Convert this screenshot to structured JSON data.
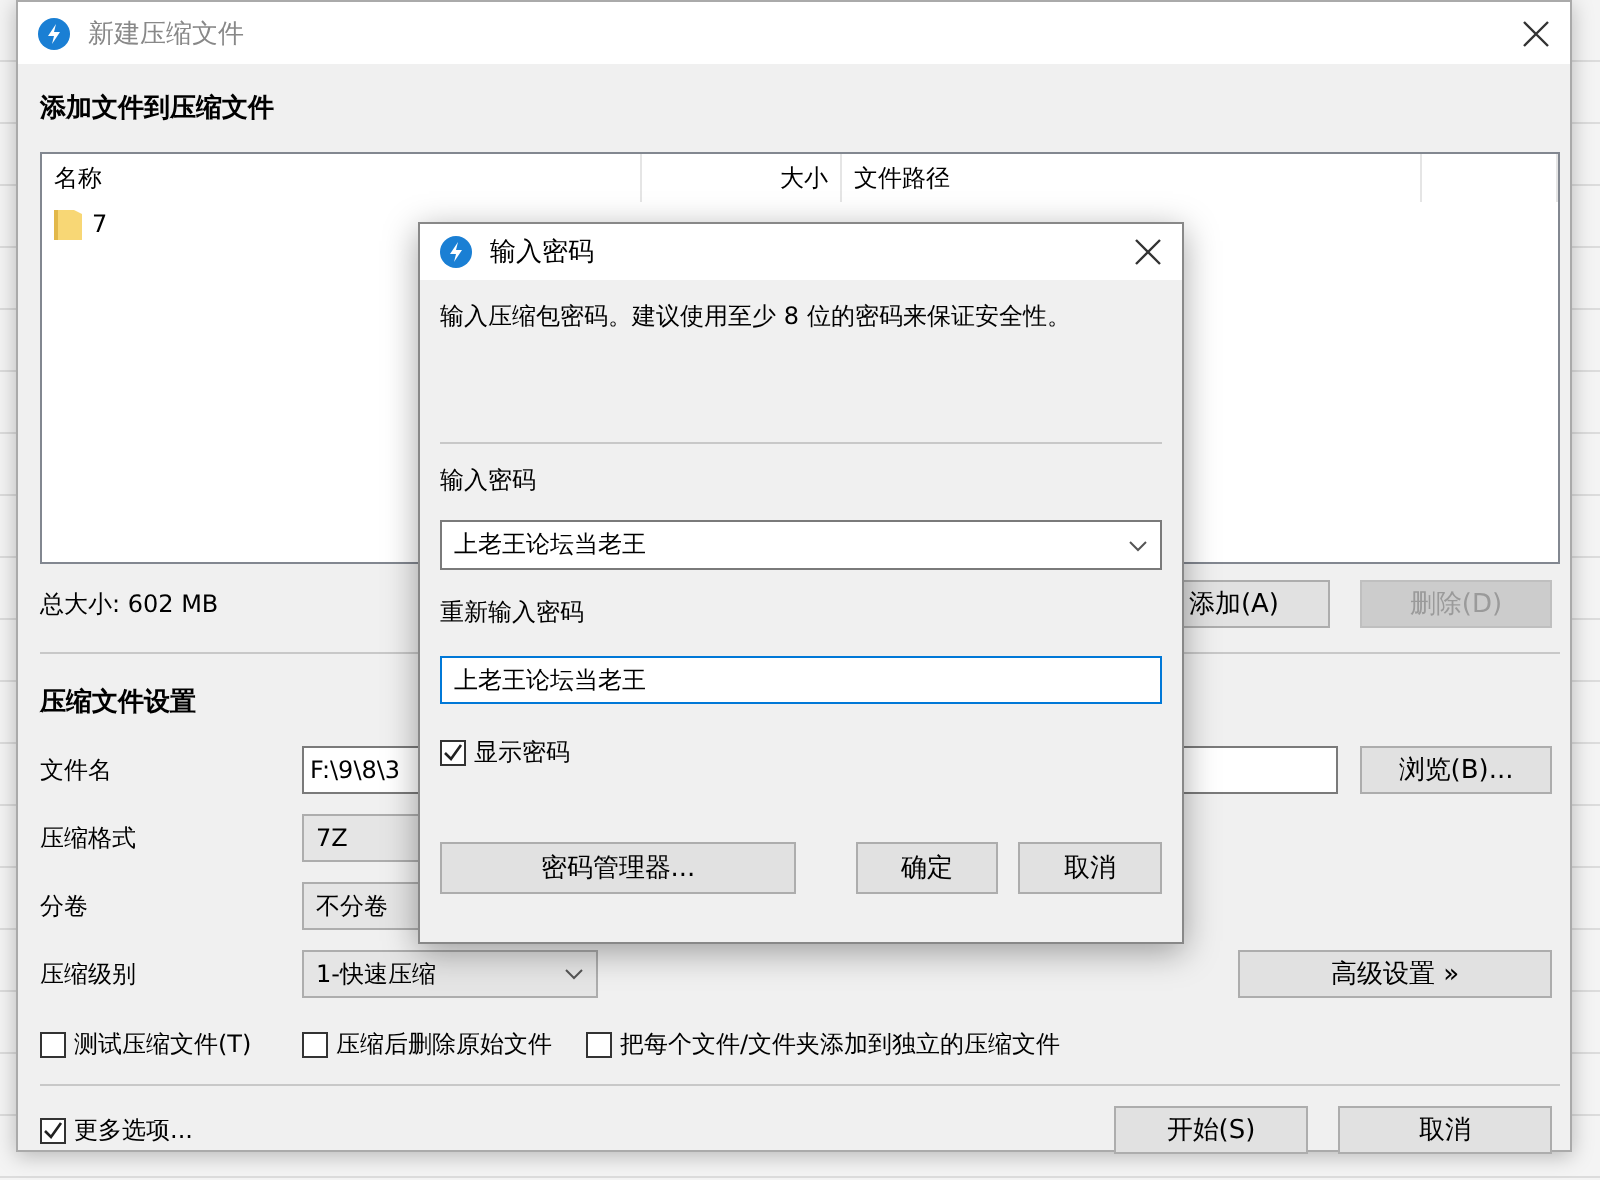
{
  "window": {
    "title": "新建压缩文件",
    "active": false
  },
  "files_section": {
    "title": "添加文件到压缩文件",
    "columns": [
      "名称",
      "大小",
      "文件路径"
    ],
    "rows": [
      {
        "name": "7"
      }
    ],
    "total": "总大小: 602 MB",
    "buttons": [
      {
        "label": "添加(A)",
        "disabled": false
      },
      {
        "label": "删除(D)",
        "disabled": true
      }
    ]
  },
  "settings": {
    "title": "压缩文件设置",
    "fields": [
      {
        "label": "文件名",
        "kind": "text",
        "value": "F:\\9\\8\\3"
      },
      {
        "label": "压缩格式",
        "kind": "combo",
        "value": "7Z"
      },
      {
        "label": "分卷",
        "kind": "combo",
        "value": "不分卷"
      },
      {
        "label": "压缩级别",
        "kind": "select",
        "value": "1-快速压缩"
      }
    ],
    "browse_button": "浏览(B)...",
    "advanced_button": "高级设置 »",
    "options": [
      {
        "label": "测试压缩文件(T)",
        "checked": false
      },
      {
        "label": "压缩后删除原始文件",
        "checked": false
      },
      {
        "label": "把每个文件/文件夹添加到独立的压缩文件",
        "checked": false
      }
    ]
  },
  "more_options": {
    "label": "更多选项...",
    "checked": true
  },
  "buttons": [
    "开始(S)",
    "取消"
  ],
  "dialog": {
    "title": "输入密码",
    "hint": "输入压缩包密码。建议使用至少 8 位的密码来保证安全性。",
    "password_label": "输入密码",
    "password": "上老王论坛当老王",
    "confirm_label": "重新输入密码",
    "confirm": "上老王论坛当老王",
    "show_password": {
      "label": "显示密码",
      "checked": true
    },
    "manager_button": "密码管理器...",
    "buttons": [
      "确定",
      "取消"
    ]
  }
}
